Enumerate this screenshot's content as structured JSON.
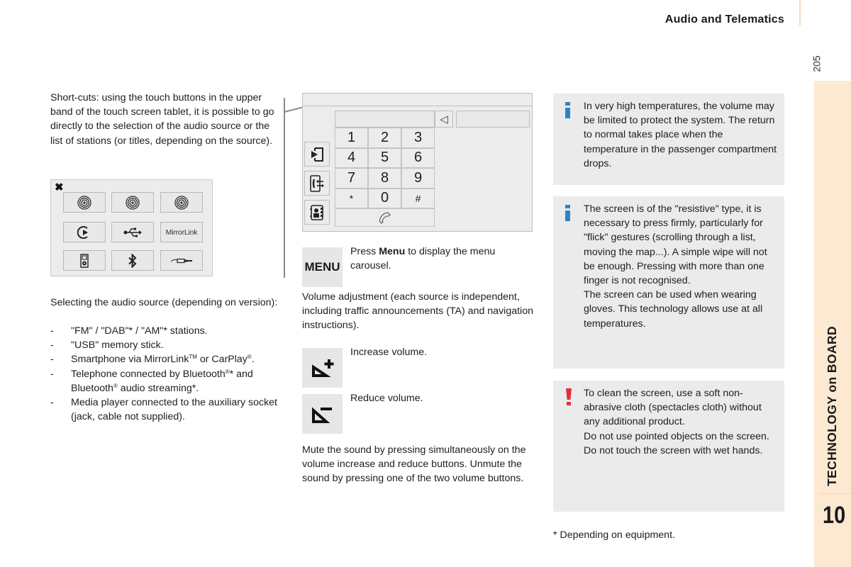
{
  "header": {
    "section_title": "Audio and Telematics",
    "page_number": "205"
  },
  "chapter_tab": {
    "label": "TECHNOLOGY on BOARD",
    "number": "10",
    "color": "#fde8d2"
  },
  "shortcuts": {
    "text": "Short-cuts: using the touch buttons in the upper band of the touch screen tablet, it is possible to go directly to the selection of the audio source or the list of stations (or titles, depending on the source)."
  },
  "source_panel": {
    "close_icon": "close-icon",
    "buttons": [
      {
        "icon": "radio-icon",
        "label": ""
      },
      {
        "icon": "radio-icon",
        "label": ""
      },
      {
        "icon": "radio-icon",
        "label": ""
      },
      {
        "icon": "streaming-play-icon",
        "label": ""
      },
      {
        "icon": "usb-icon",
        "label": ""
      },
      {
        "icon": "mirrorlink-logo",
        "label": "MirrorLink"
      },
      {
        "icon": "media-player-icon",
        "label": ""
      },
      {
        "icon": "bluetooth-icon",
        "label": ""
      },
      {
        "icon": "jack-cable-icon",
        "label": ""
      }
    ]
  },
  "audio_source": {
    "intro": "Selecting the audio source (depending on version):",
    "items": [
      {
        "dash": "-",
        "text": "\"FM\" / \"DAB\"* / \"AM\"* stations."
      },
      {
        "dash": "-",
        "text": "\"USB\" memory stick."
      },
      {
        "dash": "-",
        "text_a": "Smartphone via MirrorLink",
        "sup_a": "TM",
        "text_b": " or CarPlay",
        "sup_b": "®",
        "text_c": "."
      },
      {
        "dash": "-",
        "text_a": "Telephone connected by Bluetooth",
        "sup_a": "®",
        "text_b": "* and Bluetooth",
        "sup_b": "®",
        "text_c": " audio streaming*."
      },
      {
        "dash": "-",
        "text": "Media player connected to the auxiliary socket (jack, cable not supplied)."
      }
    ]
  },
  "phone_screen": {
    "keys": [
      "1",
      "2",
      "3",
      "4",
      "5",
      "6",
      "7",
      "8",
      "9",
      "*",
      "0",
      "#"
    ],
    "backspace_glyph": "◁",
    "side_buttons": [
      "source-input-icon",
      "call-transfer-icon",
      "contacts-icon"
    ]
  },
  "menu": {
    "button_label": "MENU",
    "text_prefix": "Press ",
    "text_bold": "Menu",
    "text_suffix": " to display the menu carousel."
  },
  "volume": {
    "intro": "Volume adjustment (each source is independent, including traffic announcements (TA) and navigation instructions).",
    "increase": "Increase volume.",
    "reduce": "Reduce volume.",
    "mute": "Mute the sound by pressing simultaneously on the volume increase and reduce buttons. Unmute the sound by pressing one of the two volume buttons."
  },
  "notes": [
    {
      "type": "info",
      "color": "#2a85c7",
      "text": "In very high temperatures, the volume may be limited to protect the system. The return to normal takes place when the temperature in the passenger compartment drops."
    },
    {
      "type": "info",
      "color": "#2a85c7",
      "text_1": "The screen is of the \"resistive\" type, it is necessary to press firmly, particularly for \"flick\" gestures (scrolling through a list, moving the map...). A simple wipe will not be enough. Pressing with more than one finger is not recognised.",
      "text_2": "The screen can be used when wearing gloves. This technology allows use at all temperatures."
    },
    {
      "type": "warning",
      "color": "#e03040",
      "text_1": "To clean the screen, use a soft non-abrasive cloth (spectacles cloth) without any additional product.",
      "text_2": "Do not use pointed objects on the screen.",
      "text_3": "Do not touch the screen with wet hands."
    }
  ],
  "footnote": "* Depending on equipment."
}
